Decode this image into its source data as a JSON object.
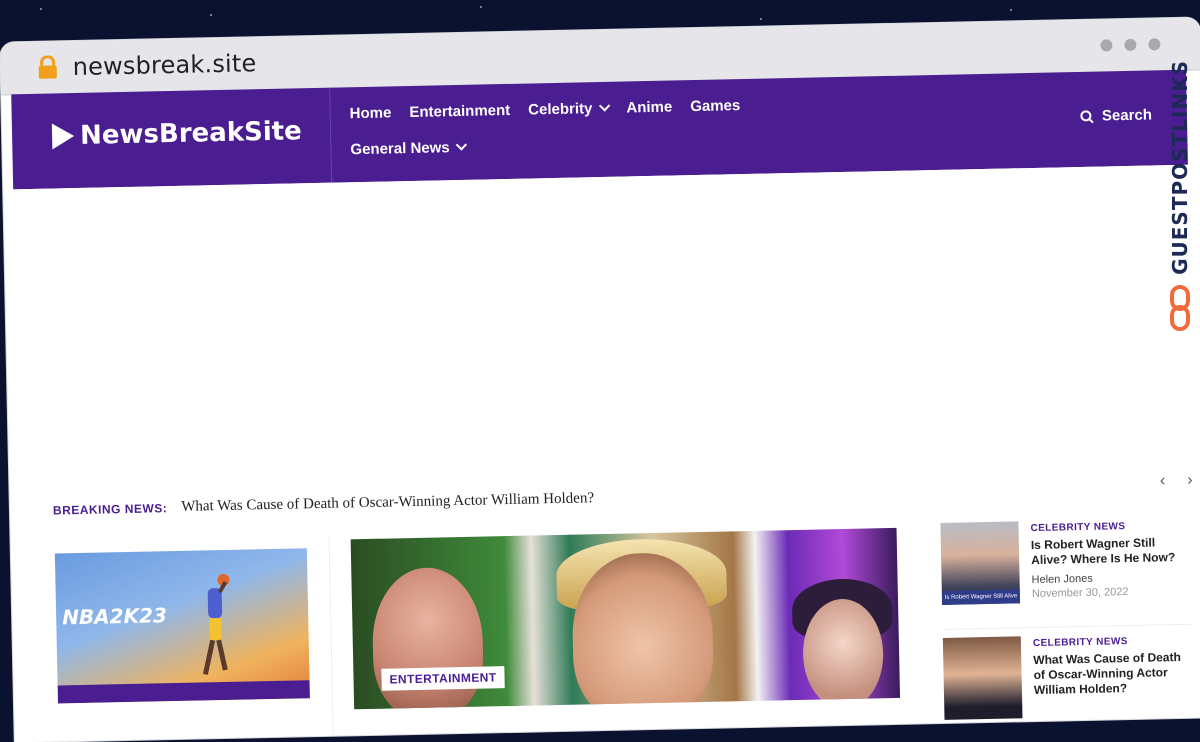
{
  "browser": {
    "url": "newsbreak.site"
  },
  "site": {
    "logo": "NewsBreakSite",
    "nav": {
      "row1": [
        {
          "label": "Home",
          "dropdown": false
        },
        {
          "label": "Entertainment",
          "dropdown": false
        },
        {
          "label": "Celebrity",
          "dropdown": true
        },
        {
          "label": "Anime",
          "dropdown": false
        },
        {
          "label": "Games",
          "dropdown": false
        }
      ],
      "row2": [
        {
          "label": "General News",
          "dropdown": true
        }
      ],
      "search_label": "Search"
    },
    "breaking": {
      "label": "BREAKING NEWS:",
      "headline": "What Was Cause of Death of Oscar-Winning Actor William Holden?"
    },
    "cards": {
      "left_image_text": "NBA2K23",
      "mid_tag": "ENTERTAINMENT"
    },
    "sidebar": [
      {
        "category": "CELEBRITY NEWS",
        "title": "Is Robert Wagner Still Alive? Where Is He Now?",
        "author": "Helen Jones",
        "date": "November 30, 2022",
        "thumb_caption": "Is Robert Wagner Still Alive"
      },
      {
        "category": "CELEBRITY NEWS",
        "title": "What Was Cause of Death of Oscar-Winning Actor William Holden?"
      }
    ],
    "colors": {
      "brand": "#4a1d91",
      "watermark": "#1d2a55",
      "watermark_accent": "#f26b3a"
    }
  },
  "watermark": {
    "text": "GUESTPOSTLINKS"
  }
}
